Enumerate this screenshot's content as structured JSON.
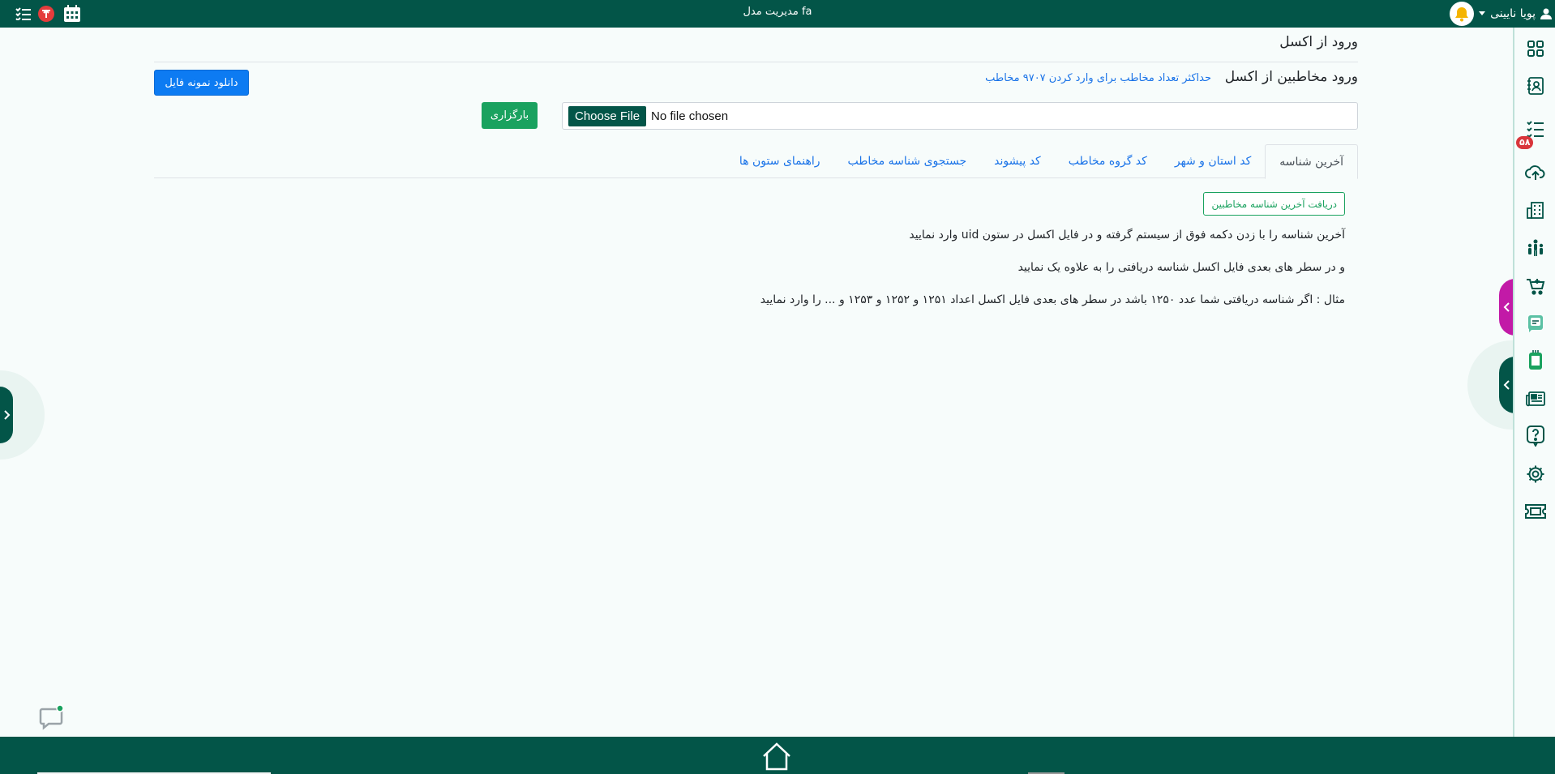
{
  "header": {
    "title": "مدیریت مدل fa",
    "user_name": "پویا نایینی"
  },
  "page": {
    "title": "ورود از اکسل",
    "section_title": "ورود مخاطبین از اکسل",
    "max_note": "حداکثر تعداد مخاطب برای وارد کردن ۹۷۰۷ مخاطب",
    "download_label": "دانلود نمونه فایل",
    "upload_label": "بارگزاری",
    "file_input": {
      "button_label": "Choose File",
      "status": "No file chosen"
    }
  },
  "tabs": [
    {
      "label": "آخرین شناسه",
      "active": true
    },
    {
      "label": "کد استان و شهر",
      "active": false
    },
    {
      "label": "کد گروه مخاطب",
      "active": false
    },
    {
      "label": "کد پیشوند",
      "active": false
    },
    {
      "label": "جستجوی شناسه مخاطب",
      "active": false
    },
    {
      "label": "راهنمای ستون ها",
      "active": false
    }
  ],
  "tab_content": {
    "button_label": "دریافت آخرین شناسه مخاطبین",
    "lines": [
      "آخرین شناسه را با زدن دکمه فوق از سیستم گرفته و در فایل اکسل در ستون uid وارد نمایید",
      "و در سطر های بعدی فایل اکسل شناسه دریافتی را به علاوه یک نمایید",
      "مثال : اگر شناسه دریافتی شما عدد ۱۲۵۰ باشد در سطر های بعدی فایل اکسل اعداد ۱۲۵۱ و ۱۲۵۲ و ۱۲۵۳ و ... را وارد نمایید"
    ]
  },
  "sidebar": {
    "badge_count": "۵۸",
    "icons": [
      "dashboard-icon",
      "contacts-book-icon",
      "checklist-icon",
      "cloud-upload-icon",
      "building-icon",
      "users-group-icon",
      "cart-icon",
      "sms-icon",
      "mobile-icon",
      "news-icon",
      "help-icon",
      "settings-icon",
      "ticket-icon"
    ]
  },
  "colors": {
    "primary": "#035548",
    "accent_green": "#1aa25f",
    "link_blue": "#1a73e8",
    "button_blue": "#0d7bf2",
    "badge_red": "#d9353b",
    "pink_tab": "#c21aa7"
  }
}
